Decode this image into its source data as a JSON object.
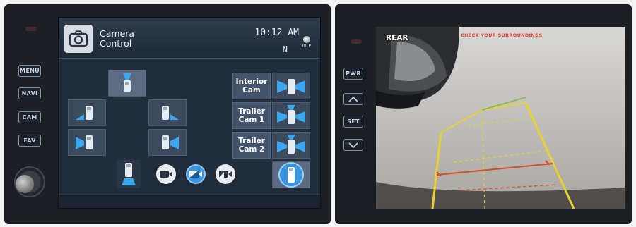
{
  "hardware_buttons": {
    "left": [
      "MENU",
      "NAVI",
      "CAM",
      "FAV"
    ],
    "right_pwr": "PWR",
    "right_set": "SET"
  },
  "header": {
    "title": "Camera\nControl",
    "time": "10:12 AM",
    "compass": "N",
    "status": "IDLE"
  },
  "camera_labels": {
    "interior": "Interior\nCam",
    "trailer1": "Trailer\nCam 1",
    "trailer2": "Trailer\nCam 2"
  },
  "rear_camera": {
    "label": "REAR",
    "warning": "CHECK YOUR SURROUNDINGS"
  },
  "colors": {
    "accent_blue": "#3ba6ee",
    "warning_red": "#e33d2a",
    "guide_yellow": "#e9d22f",
    "guide_red": "#d44b2a",
    "guide_green": "#8fb84a"
  },
  "icons": {
    "header": "camera-icon",
    "tiles": "vehicle-camera-view-icon",
    "bottom_buttons": [
      "top-view-icon",
      "camera-record-icon",
      "camera-split-icon",
      "camera-fill-icon",
      "vehicle-round-icon"
    ]
  }
}
